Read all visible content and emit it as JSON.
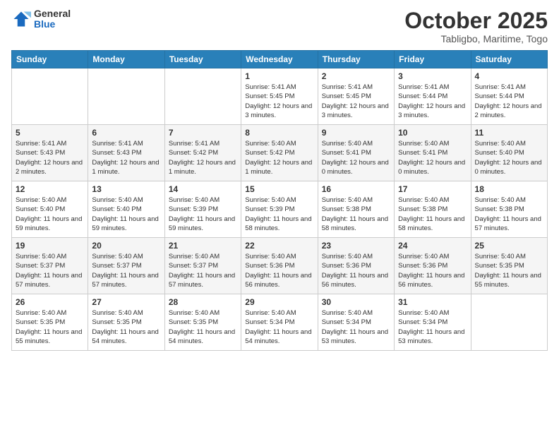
{
  "logo": {
    "general": "General",
    "blue": "Blue"
  },
  "header": {
    "month": "October 2025",
    "location": "Tabligbo, Maritime, Togo"
  },
  "weekdays": [
    "Sunday",
    "Monday",
    "Tuesday",
    "Wednesday",
    "Thursday",
    "Friday",
    "Saturday"
  ],
  "weeks": [
    [
      {
        "day": "",
        "sunrise": "",
        "sunset": "",
        "daylight": ""
      },
      {
        "day": "",
        "sunrise": "",
        "sunset": "",
        "daylight": ""
      },
      {
        "day": "",
        "sunrise": "",
        "sunset": "",
        "daylight": ""
      },
      {
        "day": "1",
        "sunrise": "Sunrise: 5:41 AM",
        "sunset": "Sunset: 5:45 PM",
        "daylight": "Daylight: 12 hours and 3 minutes."
      },
      {
        "day": "2",
        "sunrise": "Sunrise: 5:41 AM",
        "sunset": "Sunset: 5:45 PM",
        "daylight": "Daylight: 12 hours and 3 minutes."
      },
      {
        "day": "3",
        "sunrise": "Sunrise: 5:41 AM",
        "sunset": "Sunset: 5:44 PM",
        "daylight": "Daylight: 12 hours and 3 minutes."
      },
      {
        "day": "4",
        "sunrise": "Sunrise: 5:41 AM",
        "sunset": "Sunset: 5:44 PM",
        "daylight": "Daylight: 12 hours and 2 minutes."
      }
    ],
    [
      {
        "day": "5",
        "sunrise": "Sunrise: 5:41 AM",
        "sunset": "Sunset: 5:43 PM",
        "daylight": "Daylight: 12 hours and 2 minutes."
      },
      {
        "day": "6",
        "sunrise": "Sunrise: 5:41 AM",
        "sunset": "Sunset: 5:43 PM",
        "daylight": "Daylight: 12 hours and 1 minute."
      },
      {
        "day": "7",
        "sunrise": "Sunrise: 5:41 AM",
        "sunset": "Sunset: 5:42 PM",
        "daylight": "Daylight: 12 hours and 1 minute."
      },
      {
        "day": "8",
        "sunrise": "Sunrise: 5:40 AM",
        "sunset": "Sunset: 5:42 PM",
        "daylight": "Daylight: 12 hours and 1 minute."
      },
      {
        "day": "9",
        "sunrise": "Sunrise: 5:40 AM",
        "sunset": "Sunset: 5:41 PM",
        "daylight": "Daylight: 12 hours and 0 minutes."
      },
      {
        "day": "10",
        "sunrise": "Sunrise: 5:40 AM",
        "sunset": "Sunset: 5:41 PM",
        "daylight": "Daylight: 12 hours and 0 minutes."
      },
      {
        "day": "11",
        "sunrise": "Sunrise: 5:40 AM",
        "sunset": "Sunset: 5:40 PM",
        "daylight": "Daylight: 12 hours and 0 minutes."
      }
    ],
    [
      {
        "day": "12",
        "sunrise": "Sunrise: 5:40 AM",
        "sunset": "Sunset: 5:40 PM",
        "daylight": "Daylight: 11 hours and 59 minutes."
      },
      {
        "day": "13",
        "sunrise": "Sunrise: 5:40 AM",
        "sunset": "Sunset: 5:40 PM",
        "daylight": "Daylight: 11 hours and 59 minutes."
      },
      {
        "day": "14",
        "sunrise": "Sunrise: 5:40 AM",
        "sunset": "Sunset: 5:39 PM",
        "daylight": "Daylight: 11 hours and 59 minutes."
      },
      {
        "day": "15",
        "sunrise": "Sunrise: 5:40 AM",
        "sunset": "Sunset: 5:39 PM",
        "daylight": "Daylight: 11 hours and 58 minutes."
      },
      {
        "day": "16",
        "sunrise": "Sunrise: 5:40 AM",
        "sunset": "Sunset: 5:38 PM",
        "daylight": "Daylight: 11 hours and 58 minutes."
      },
      {
        "day": "17",
        "sunrise": "Sunrise: 5:40 AM",
        "sunset": "Sunset: 5:38 PM",
        "daylight": "Daylight: 11 hours and 58 minutes."
      },
      {
        "day": "18",
        "sunrise": "Sunrise: 5:40 AM",
        "sunset": "Sunset: 5:38 PM",
        "daylight": "Daylight: 11 hours and 57 minutes."
      }
    ],
    [
      {
        "day": "19",
        "sunrise": "Sunrise: 5:40 AM",
        "sunset": "Sunset: 5:37 PM",
        "daylight": "Daylight: 11 hours and 57 minutes."
      },
      {
        "day": "20",
        "sunrise": "Sunrise: 5:40 AM",
        "sunset": "Sunset: 5:37 PM",
        "daylight": "Daylight: 11 hours and 57 minutes."
      },
      {
        "day": "21",
        "sunrise": "Sunrise: 5:40 AM",
        "sunset": "Sunset: 5:37 PM",
        "daylight": "Daylight: 11 hours and 57 minutes."
      },
      {
        "day": "22",
        "sunrise": "Sunrise: 5:40 AM",
        "sunset": "Sunset: 5:36 PM",
        "daylight": "Daylight: 11 hours and 56 minutes."
      },
      {
        "day": "23",
        "sunrise": "Sunrise: 5:40 AM",
        "sunset": "Sunset: 5:36 PM",
        "daylight": "Daylight: 11 hours and 56 minutes."
      },
      {
        "day": "24",
        "sunrise": "Sunrise: 5:40 AM",
        "sunset": "Sunset: 5:36 PM",
        "daylight": "Daylight: 11 hours and 56 minutes."
      },
      {
        "day": "25",
        "sunrise": "Sunrise: 5:40 AM",
        "sunset": "Sunset: 5:35 PM",
        "daylight": "Daylight: 11 hours and 55 minutes."
      }
    ],
    [
      {
        "day": "26",
        "sunrise": "Sunrise: 5:40 AM",
        "sunset": "Sunset: 5:35 PM",
        "daylight": "Daylight: 11 hours and 55 minutes."
      },
      {
        "day": "27",
        "sunrise": "Sunrise: 5:40 AM",
        "sunset": "Sunset: 5:35 PM",
        "daylight": "Daylight: 11 hours and 54 minutes."
      },
      {
        "day": "28",
        "sunrise": "Sunrise: 5:40 AM",
        "sunset": "Sunset: 5:35 PM",
        "daylight": "Daylight: 11 hours and 54 minutes."
      },
      {
        "day": "29",
        "sunrise": "Sunrise: 5:40 AM",
        "sunset": "Sunset: 5:34 PM",
        "daylight": "Daylight: 11 hours and 54 minutes."
      },
      {
        "day": "30",
        "sunrise": "Sunrise: 5:40 AM",
        "sunset": "Sunset: 5:34 PM",
        "daylight": "Daylight: 11 hours and 53 minutes."
      },
      {
        "day": "31",
        "sunrise": "Sunrise: 5:40 AM",
        "sunset": "Sunset: 5:34 PM",
        "daylight": "Daylight: 11 hours and 53 minutes."
      },
      {
        "day": "",
        "sunrise": "",
        "sunset": "",
        "daylight": ""
      }
    ]
  ]
}
